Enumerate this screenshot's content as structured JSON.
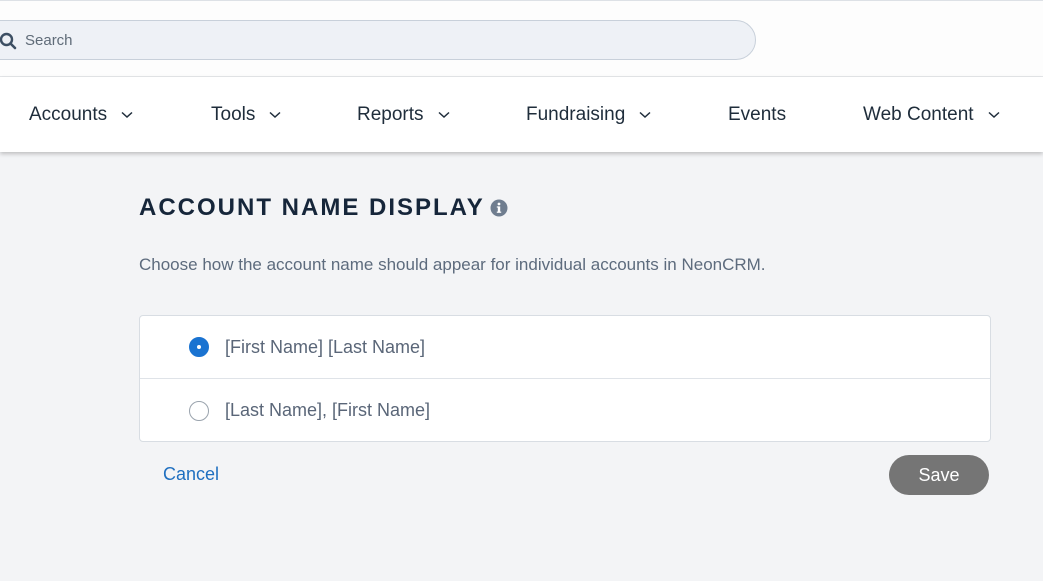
{
  "search": {
    "placeholder": "Search",
    "value": "",
    "icon": "search-icon"
  },
  "nav": {
    "items": [
      {
        "label": "Accounts",
        "has_dropdown": true
      },
      {
        "label": "Tools",
        "has_dropdown": true
      },
      {
        "label": "Reports",
        "has_dropdown": true
      },
      {
        "label": "Fundraising",
        "has_dropdown": true
      },
      {
        "label": "Events",
        "has_dropdown": false
      },
      {
        "label": "Web Content",
        "has_dropdown": true
      }
    ]
  },
  "page": {
    "title": "ACCOUNT NAME DISPLAY",
    "info_icon": "info-icon",
    "description": "Choose how the account name should appear for individual accounts in NeonCRM."
  },
  "options": [
    {
      "label": "[First Name] [Last Name]",
      "selected": true
    },
    {
      "label": "[Last Name], [First Name]",
      "selected": false
    }
  ],
  "actions": {
    "cancel_label": "Cancel",
    "save_label": "Save"
  },
  "colors": {
    "accent": "#1a73d1",
    "link": "#1f6fc0",
    "save_button": "#757575",
    "background": "#f3f4f6"
  }
}
